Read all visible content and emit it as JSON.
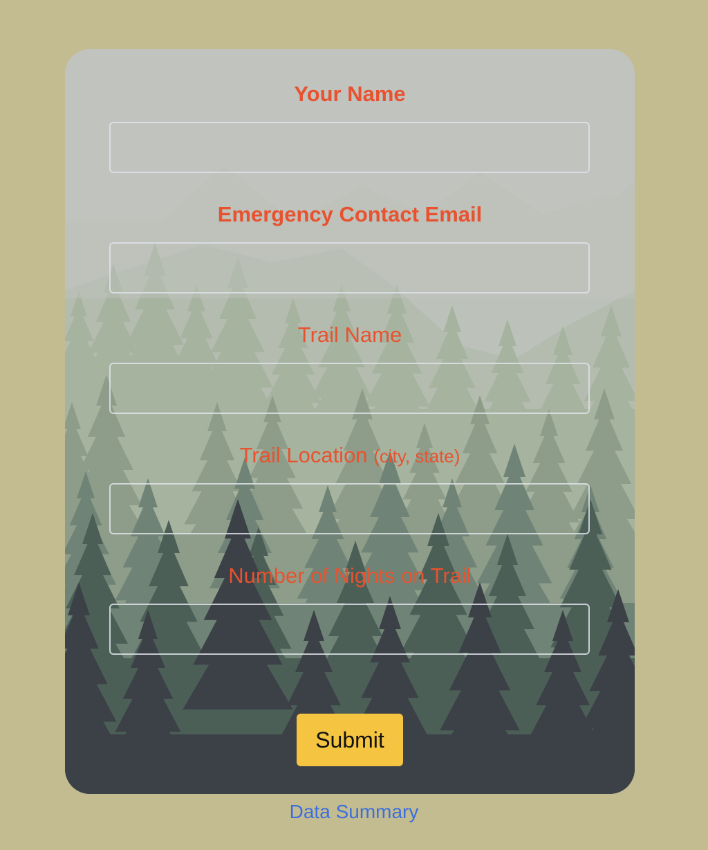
{
  "form": {
    "fields": [
      {
        "label": "Your Name",
        "hint": "",
        "value": "",
        "placeholder": ""
      },
      {
        "label": "Emergency Contact Email",
        "hint": "",
        "value": "",
        "placeholder": ""
      },
      {
        "label": "Trail Name",
        "hint": "",
        "value": "",
        "placeholder": ""
      },
      {
        "label": "Trail Location",
        "hint": "(city, state)",
        "value": "",
        "placeholder": ""
      },
      {
        "label": "Number of Nights on Trail",
        "hint": "",
        "value": "",
        "placeholder": ""
      }
    ],
    "submit_label": "Submit"
  },
  "footer": {
    "link_label": "Data Summary"
  },
  "colors": {
    "page_background": "#c4bc91",
    "label_color": "#e8522f",
    "submit_background": "#f5c542",
    "link_color": "#3c6fdc"
  },
  "icons": {
    "background_art": "forest-mountains-illustration"
  }
}
